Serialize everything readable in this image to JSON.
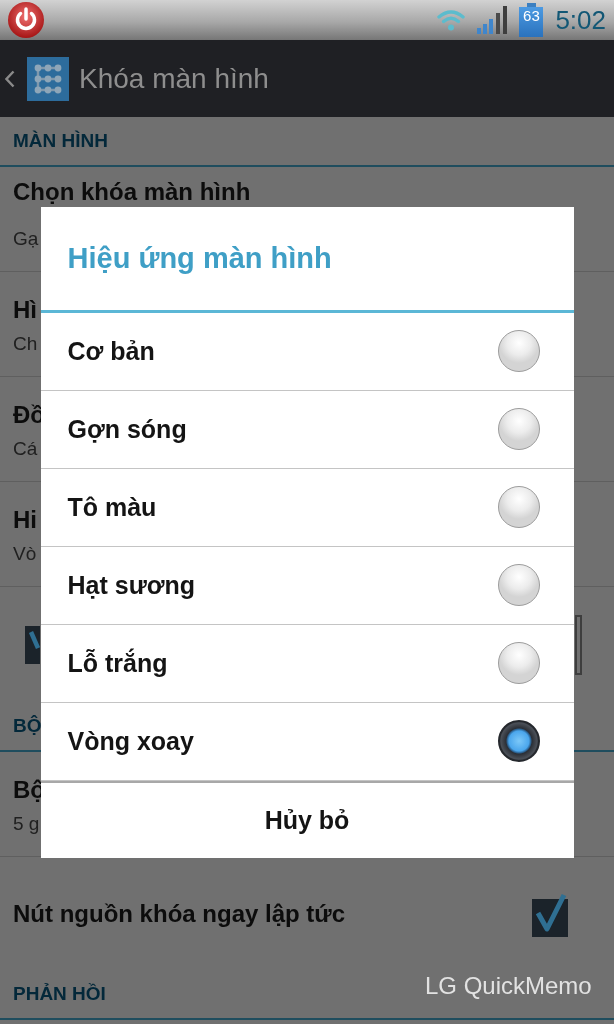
{
  "status_bar": {
    "battery": "63",
    "time": "5:02"
  },
  "action_bar": {
    "title": "Khóa màn hình"
  },
  "settings": [
    {
      "kind": "header",
      "label": "MÀN HÌNH"
    },
    {
      "kind": "item",
      "title": "Chọn khóa màn hình",
      "subtitle": "Gạ"
    },
    {
      "kind": "item",
      "title": "Hì",
      "subtitle": "Ch"
    },
    {
      "kind": "item",
      "title": "Đồ",
      "subtitle": "Cá"
    },
    {
      "kind": "item",
      "title": "Hi",
      "subtitle": "Vò"
    },
    {
      "kind": "widget",
      "checked": true
    },
    {
      "kind": "header",
      "label": "BỘ"
    },
    {
      "kind": "item",
      "title": "Bộ",
      "subtitle": "5 g"
    },
    {
      "kind": "toggle",
      "title": "Nút nguồn khóa ngay lập tức",
      "checked": true
    },
    {
      "kind": "header",
      "label": "PHẢN HỒI"
    }
  ],
  "stamp": "LG QuickMemo",
  "dialog": {
    "title": "Hiệu ứng màn hình",
    "options": [
      {
        "label": "Cơ bản",
        "selected": false
      },
      {
        "label": "Gợn sóng",
        "selected": false
      },
      {
        "label": "Tô màu",
        "selected": false
      },
      {
        "label": "Hạt sương",
        "selected": false
      },
      {
        "label": "Lỗ trắng",
        "selected": false
      },
      {
        "label": "Vòng xoay",
        "selected": true
      }
    ],
    "cancel_button": "Hủy bỏ"
  }
}
